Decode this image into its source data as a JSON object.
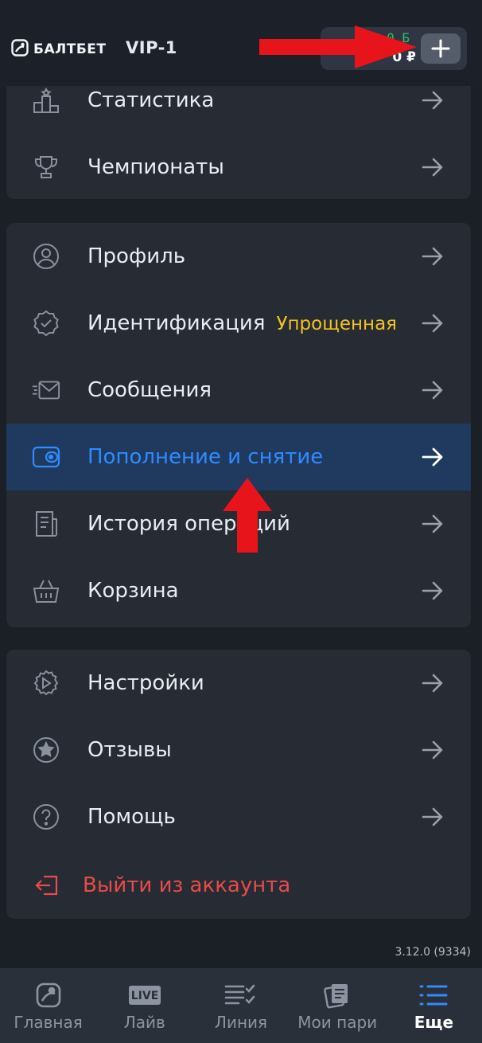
{
  "header": {
    "logo_text": "БАЛТБЕТ",
    "vip_label": "VIP-1",
    "bonus_balance": "0 Б",
    "rub_balance": "0 ₽",
    "plus_label": "+"
  },
  "menu": {
    "group1": [
      {
        "label": "Статистика",
        "icon": "podium-icon"
      },
      {
        "label": "Чемпионаты",
        "icon": "trophy-icon"
      }
    ],
    "group2": [
      {
        "label": "Профиль",
        "icon": "profile-icon"
      },
      {
        "label": "Идентификация",
        "badge": "Упрощенная",
        "icon": "verification-badge-icon"
      },
      {
        "label": "Сообщения",
        "icon": "envelope-icon"
      },
      {
        "label": "Пополнение и снятие",
        "icon": "wallet-icon",
        "active": true
      },
      {
        "label": "История операций",
        "icon": "receipt-icon"
      },
      {
        "label": "Корзина",
        "icon": "basket-icon"
      }
    ],
    "group3": [
      {
        "label": "Настройки",
        "icon": "settings-icon"
      },
      {
        "label": "Отзывы",
        "icon": "star-icon"
      },
      {
        "label": "Помощь",
        "icon": "help-icon"
      },
      {
        "label": "Выйти из аккаунта",
        "icon": "logout-icon"
      }
    ]
  },
  "version": "3.12.0 (9334)",
  "bottom_nav": [
    {
      "label": "Главная",
      "icon": "home-ball-icon"
    },
    {
      "label": "Лайв",
      "icon": "live-icon",
      "icon_text": "LIVE"
    },
    {
      "label": "Линия",
      "icon": "checklist-icon"
    },
    {
      "label": "Мои пари",
      "icon": "bets-icon"
    },
    {
      "label": "Еще",
      "icon": "more-list-icon",
      "active": true
    }
  ],
  "colors": {
    "accent_blue": "#2f8bff",
    "badge_yellow": "#f4c21f",
    "logout_red": "#e94a4a",
    "bonus_green": "#27c268"
  }
}
